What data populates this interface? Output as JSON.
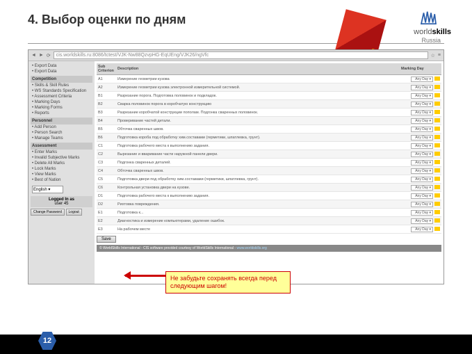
{
  "slide": {
    "title": "4. Выбор оценки по дням",
    "page": "12"
  },
  "logo": {
    "brand1": "world",
    "brand2": "skills",
    "sub": "Russia"
  },
  "browser": {
    "url": "cis.worldskills.ru:8086/tctest/VJK-Nw88QzvpHG-EqUEng/VJK26/ngVfc"
  },
  "sidebar": {
    "top": [
      "• Export Data",
      "• Export Data"
    ],
    "h1": "Competition",
    "g1": [
      "• Skills & Skill Rules",
      "• WS Standards Specification",
      "• Assessment Criteria",
      "• Marking Days",
      "• Marking Forms",
      "• Reports"
    ],
    "h2": "Personnel",
    "g2": [
      "• Add Person",
      "• Person Search",
      "• Manage Teams"
    ],
    "h3": "Assessment",
    "g3": [
      "• Enter Marks",
      "• Invalid Subjective Marks",
      "• Delete All Marks",
      "• Lock Marks",
      "• View Marks",
      "• Best of Nation"
    ],
    "lang": "English",
    "login_head": "Logged In as",
    "login_user": "user 45",
    "change": "Change Password",
    "logout": "Logout"
  },
  "table": {
    "h1": "Sub Criterion",
    "h2": "Description",
    "h3": "Marking Day",
    "rows": [
      {
        "c": "A1",
        "d": "Измерение геометрии кузова"
      },
      {
        "c": "A2",
        "d": "Измерение геометрии кузова электронной измерительной системой."
      },
      {
        "c": "B1",
        "d": "Разрезание порога. Подготовка половинок и подкладок."
      },
      {
        "c": "B2",
        "d": "Сварка половинок порога в коробчатую конструкцию"
      },
      {
        "c": "B3",
        "d": "Разрезание коробчатой конструкции пополам. Подгонка сваренных половинок."
      },
      {
        "c": "B4",
        "d": "Проверивание частей детали."
      },
      {
        "c": "B5",
        "d": "Обточка сваренных швов."
      },
      {
        "c": "B6",
        "d": "Подготовка короба под обработку хим.составами (герметики, шпатлевка, грунт)."
      },
      {
        "c": "C1",
        "d": "Подготовка рабочего места к выполнению задания."
      },
      {
        "c": "C2",
        "d": "Вырезание и вваривание части наружной панели двери."
      },
      {
        "c": "C3",
        "d": "Подгонка сваренных деталей."
      },
      {
        "c": "C4",
        "d": "Обточка сваренных швов."
      },
      {
        "c": "C5",
        "d": "Подготовка двери под обработку хим.составами (герметики, шпатлевка, грунт)."
      },
      {
        "c": "C6",
        "d": "Контрольная установка двери на кузове."
      },
      {
        "c": "D1",
        "d": "Подготовка рабочего места к выполнению задания."
      },
      {
        "c": "D2",
        "d": "Рихтовка повреждения."
      },
      {
        "c": "E1",
        "d": "Подготовка к..."
      },
      {
        "c": "E2",
        "d": "Диагностика и измерение компьютерами, удаление ошибок."
      },
      {
        "c": "E3",
        "d": "На рабочем месте"
      }
    ],
    "day": "Any Day",
    "save": "Save"
  },
  "callout": "Не забудьте сохранять всегда перед следующим шагом!",
  "foot": {
    "t": "© WorldSkills International - CIS software provided courtesy of WorldSkills International - ",
    "link": "www.worldskills.org"
  }
}
